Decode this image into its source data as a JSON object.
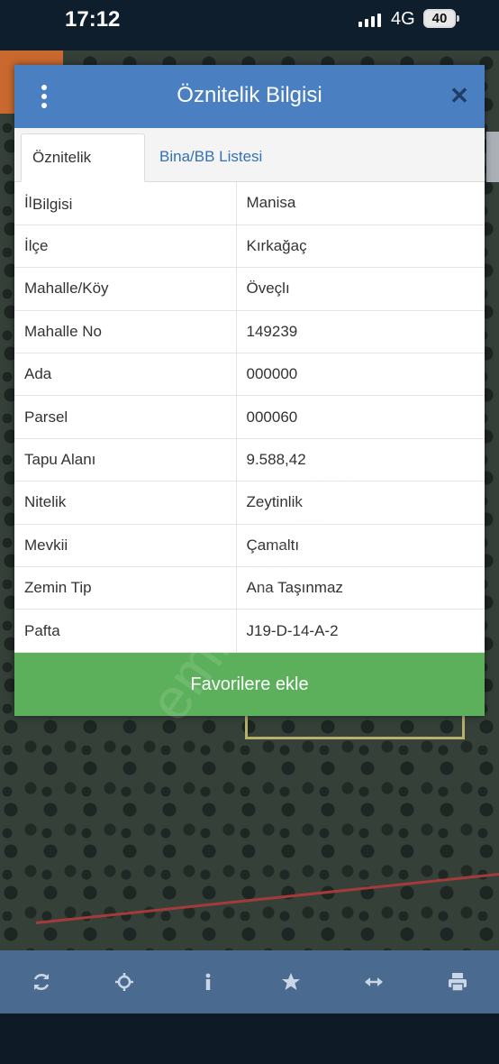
{
  "status_bar": {
    "time": "17:12",
    "network": "4G",
    "battery": "40"
  },
  "dialog": {
    "title": "Öznitelik Bilgisi",
    "tabs": [
      {
        "label": "Öznitelik Bilgisi",
        "active": true
      },
      {
        "label": "Bina/BB Listesi",
        "active": false
      }
    ],
    "rows": [
      {
        "key": "İl",
        "value": "Manisa"
      },
      {
        "key": "İlçe",
        "value": "Kırkağaç"
      },
      {
        "key": "Mahalle/Köy",
        "value": "Öveçlı"
      },
      {
        "key": "Mahalle No",
        "value": "149239"
      },
      {
        "key": "Ada",
        "value": "000000"
      },
      {
        "key": "Parsel",
        "value": "000060"
      },
      {
        "key": "Tapu Alanı",
        "value": "9.588,42"
      },
      {
        "key": "Nitelik",
        "value": "Zeytinlik"
      },
      {
        "key": "Mevkii",
        "value": "Çamaltı"
      },
      {
        "key": "Zemin Tip",
        "value": "Ana Taşınmaz"
      },
      {
        "key": "Pafta",
        "value": "J19-D-14-A-2"
      }
    ],
    "favorite_button": "Favorilere ekle"
  },
  "watermark": "emlakjet.com",
  "toolbar": {
    "icons": [
      "refresh-icon",
      "locate-icon",
      "info-icon",
      "star-icon",
      "measure-icon",
      "print-icon"
    ]
  },
  "colors": {
    "header": "#4a7fc1",
    "favorite_button": "#5cb05c",
    "toolbar": "#4a6a8f"
  }
}
